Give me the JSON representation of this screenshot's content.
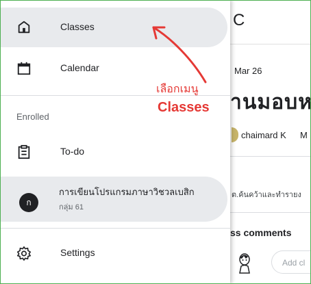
{
  "drawer": {
    "items": [
      {
        "label": "Classes",
        "icon": "home-icon",
        "active": true
      },
      {
        "label": "Calendar",
        "icon": "calendar-icon",
        "active": false
      }
    ],
    "section_label": "Enrolled",
    "todo_label": "To-do",
    "class": {
      "avatar_letter": "ก",
      "name": "การเขียนโปรแกรมภาษาวิชวลเบสิก",
      "section": "กลุ่ม 61"
    },
    "settings_label": "Settings"
  },
  "background": {
    "header_letter": "C",
    "date": "Mar 26",
    "title": "านมอบห",
    "author": "chaimard K",
    "author_suffix": "M",
    "description": "ต.ค้นคว้าและทำรายง",
    "comments_label": "ss comments",
    "comment_placeholder": "Add cl"
  },
  "annotation": {
    "line1": "เลือกเมนู",
    "line2": "Classes",
    "color": "#e53935"
  }
}
